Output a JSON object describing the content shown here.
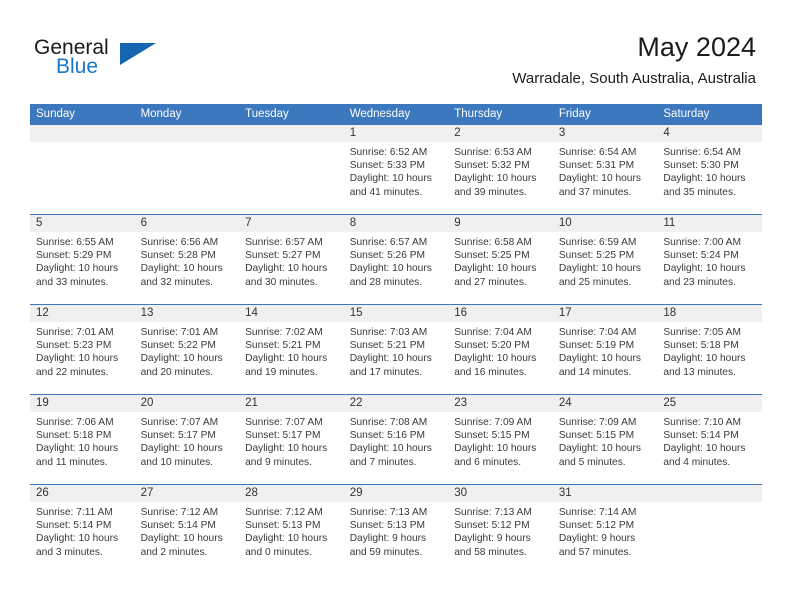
{
  "brand": {
    "name_part1": "General",
    "name_part2": "Blue",
    "triangle_icon": "triangle-logo-icon",
    "accent_color": "#1976c8"
  },
  "header": {
    "title": "May 2024",
    "subtitle": "Warradale, South Australia, Australia"
  },
  "theme": {
    "header_blue": "#3b78be",
    "day_band_gray": "#f0f0f0",
    "text_color": "#3a3a3a"
  },
  "weekday_headers": [
    "Sunday",
    "Monday",
    "Tuesday",
    "Wednesday",
    "Thursday",
    "Friday",
    "Saturday"
  ],
  "weeks": [
    [
      {
        "day": "",
        "empty": true,
        "sunrise": "",
        "sunset": "",
        "daylight_line1": "",
        "daylight_line2": ""
      },
      {
        "day": "",
        "empty": true,
        "sunrise": "",
        "sunset": "",
        "daylight_line1": "",
        "daylight_line2": ""
      },
      {
        "day": "",
        "empty": true,
        "sunrise": "",
        "sunset": "",
        "daylight_line1": "",
        "daylight_line2": ""
      },
      {
        "day": "1",
        "empty": false,
        "sunrise": "Sunrise: 6:52 AM",
        "sunset": "Sunset: 5:33 PM",
        "daylight_line1": "Daylight: 10 hours",
        "daylight_line2": "and 41 minutes."
      },
      {
        "day": "2",
        "empty": false,
        "sunrise": "Sunrise: 6:53 AM",
        "sunset": "Sunset: 5:32 PM",
        "daylight_line1": "Daylight: 10 hours",
        "daylight_line2": "and 39 minutes."
      },
      {
        "day": "3",
        "empty": false,
        "sunrise": "Sunrise: 6:54 AM",
        "sunset": "Sunset: 5:31 PM",
        "daylight_line1": "Daylight: 10 hours",
        "daylight_line2": "and 37 minutes."
      },
      {
        "day": "4",
        "empty": false,
        "sunrise": "Sunrise: 6:54 AM",
        "sunset": "Sunset: 5:30 PM",
        "daylight_line1": "Daylight: 10 hours",
        "daylight_line2": "and 35 minutes."
      }
    ],
    [
      {
        "day": "5",
        "empty": false,
        "sunrise": "Sunrise: 6:55 AM",
        "sunset": "Sunset: 5:29 PM",
        "daylight_line1": "Daylight: 10 hours",
        "daylight_line2": "and 33 minutes."
      },
      {
        "day": "6",
        "empty": false,
        "sunrise": "Sunrise: 6:56 AM",
        "sunset": "Sunset: 5:28 PM",
        "daylight_line1": "Daylight: 10 hours",
        "daylight_line2": "and 32 minutes."
      },
      {
        "day": "7",
        "empty": false,
        "sunrise": "Sunrise: 6:57 AM",
        "sunset": "Sunset: 5:27 PM",
        "daylight_line1": "Daylight: 10 hours",
        "daylight_line2": "and 30 minutes."
      },
      {
        "day": "8",
        "empty": false,
        "sunrise": "Sunrise: 6:57 AM",
        "sunset": "Sunset: 5:26 PM",
        "daylight_line1": "Daylight: 10 hours",
        "daylight_line2": "and 28 minutes."
      },
      {
        "day": "9",
        "empty": false,
        "sunrise": "Sunrise: 6:58 AM",
        "sunset": "Sunset: 5:25 PM",
        "daylight_line1": "Daylight: 10 hours",
        "daylight_line2": "and 27 minutes."
      },
      {
        "day": "10",
        "empty": false,
        "sunrise": "Sunrise: 6:59 AM",
        "sunset": "Sunset: 5:25 PM",
        "daylight_line1": "Daylight: 10 hours",
        "daylight_line2": "and 25 minutes."
      },
      {
        "day": "11",
        "empty": false,
        "sunrise": "Sunrise: 7:00 AM",
        "sunset": "Sunset: 5:24 PM",
        "daylight_line1": "Daylight: 10 hours",
        "daylight_line2": "and 23 minutes."
      }
    ],
    [
      {
        "day": "12",
        "empty": false,
        "sunrise": "Sunrise: 7:01 AM",
        "sunset": "Sunset: 5:23 PM",
        "daylight_line1": "Daylight: 10 hours",
        "daylight_line2": "and 22 minutes."
      },
      {
        "day": "13",
        "empty": false,
        "sunrise": "Sunrise: 7:01 AM",
        "sunset": "Sunset: 5:22 PM",
        "daylight_line1": "Daylight: 10 hours",
        "daylight_line2": "and 20 minutes."
      },
      {
        "day": "14",
        "empty": false,
        "sunrise": "Sunrise: 7:02 AM",
        "sunset": "Sunset: 5:21 PM",
        "daylight_line1": "Daylight: 10 hours",
        "daylight_line2": "and 19 minutes."
      },
      {
        "day": "15",
        "empty": false,
        "sunrise": "Sunrise: 7:03 AM",
        "sunset": "Sunset: 5:21 PM",
        "daylight_line1": "Daylight: 10 hours",
        "daylight_line2": "and 17 minutes."
      },
      {
        "day": "16",
        "empty": false,
        "sunrise": "Sunrise: 7:04 AM",
        "sunset": "Sunset: 5:20 PM",
        "daylight_line1": "Daylight: 10 hours",
        "daylight_line2": "and 16 minutes."
      },
      {
        "day": "17",
        "empty": false,
        "sunrise": "Sunrise: 7:04 AM",
        "sunset": "Sunset: 5:19 PM",
        "daylight_line1": "Daylight: 10 hours",
        "daylight_line2": "and 14 minutes."
      },
      {
        "day": "18",
        "empty": false,
        "sunrise": "Sunrise: 7:05 AM",
        "sunset": "Sunset: 5:18 PM",
        "daylight_line1": "Daylight: 10 hours",
        "daylight_line2": "and 13 minutes."
      }
    ],
    [
      {
        "day": "19",
        "empty": false,
        "sunrise": "Sunrise: 7:06 AM",
        "sunset": "Sunset: 5:18 PM",
        "daylight_line1": "Daylight: 10 hours",
        "daylight_line2": "and 11 minutes."
      },
      {
        "day": "20",
        "empty": false,
        "sunrise": "Sunrise: 7:07 AM",
        "sunset": "Sunset: 5:17 PM",
        "daylight_line1": "Daylight: 10 hours",
        "daylight_line2": "and 10 minutes."
      },
      {
        "day": "21",
        "empty": false,
        "sunrise": "Sunrise: 7:07 AM",
        "sunset": "Sunset: 5:17 PM",
        "daylight_line1": "Daylight: 10 hours",
        "daylight_line2": "and 9 minutes."
      },
      {
        "day": "22",
        "empty": false,
        "sunrise": "Sunrise: 7:08 AM",
        "sunset": "Sunset: 5:16 PM",
        "daylight_line1": "Daylight: 10 hours",
        "daylight_line2": "and 7 minutes."
      },
      {
        "day": "23",
        "empty": false,
        "sunrise": "Sunrise: 7:09 AM",
        "sunset": "Sunset: 5:15 PM",
        "daylight_line1": "Daylight: 10 hours",
        "daylight_line2": "and 6 minutes."
      },
      {
        "day": "24",
        "empty": false,
        "sunrise": "Sunrise: 7:09 AM",
        "sunset": "Sunset: 5:15 PM",
        "daylight_line1": "Daylight: 10 hours",
        "daylight_line2": "and 5 minutes."
      },
      {
        "day": "25",
        "empty": false,
        "sunrise": "Sunrise: 7:10 AM",
        "sunset": "Sunset: 5:14 PM",
        "daylight_line1": "Daylight: 10 hours",
        "daylight_line2": "and 4 minutes."
      }
    ],
    [
      {
        "day": "26",
        "empty": false,
        "sunrise": "Sunrise: 7:11 AM",
        "sunset": "Sunset: 5:14 PM",
        "daylight_line1": "Daylight: 10 hours",
        "daylight_line2": "and 3 minutes."
      },
      {
        "day": "27",
        "empty": false,
        "sunrise": "Sunrise: 7:12 AM",
        "sunset": "Sunset: 5:14 PM",
        "daylight_line1": "Daylight: 10 hours",
        "daylight_line2": "and 2 minutes."
      },
      {
        "day": "28",
        "empty": false,
        "sunrise": "Sunrise: 7:12 AM",
        "sunset": "Sunset: 5:13 PM",
        "daylight_line1": "Daylight: 10 hours",
        "daylight_line2": "and 0 minutes."
      },
      {
        "day": "29",
        "empty": false,
        "sunrise": "Sunrise: 7:13 AM",
        "sunset": "Sunset: 5:13 PM",
        "daylight_line1": "Daylight: 9 hours",
        "daylight_line2": "and 59 minutes."
      },
      {
        "day": "30",
        "empty": false,
        "sunrise": "Sunrise: 7:13 AM",
        "sunset": "Sunset: 5:12 PM",
        "daylight_line1": "Daylight: 9 hours",
        "daylight_line2": "and 58 minutes."
      },
      {
        "day": "31",
        "empty": false,
        "sunrise": "Sunrise: 7:14 AM",
        "sunset": "Sunset: 5:12 PM",
        "daylight_line1": "Daylight: 9 hours",
        "daylight_line2": "and 57 minutes."
      },
      {
        "day": "",
        "empty": true,
        "sunrise": "",
        "sunset": "",
        "daylight_line1": "",
        "daylight_line2": ""
      }
    ]
  ]
}
